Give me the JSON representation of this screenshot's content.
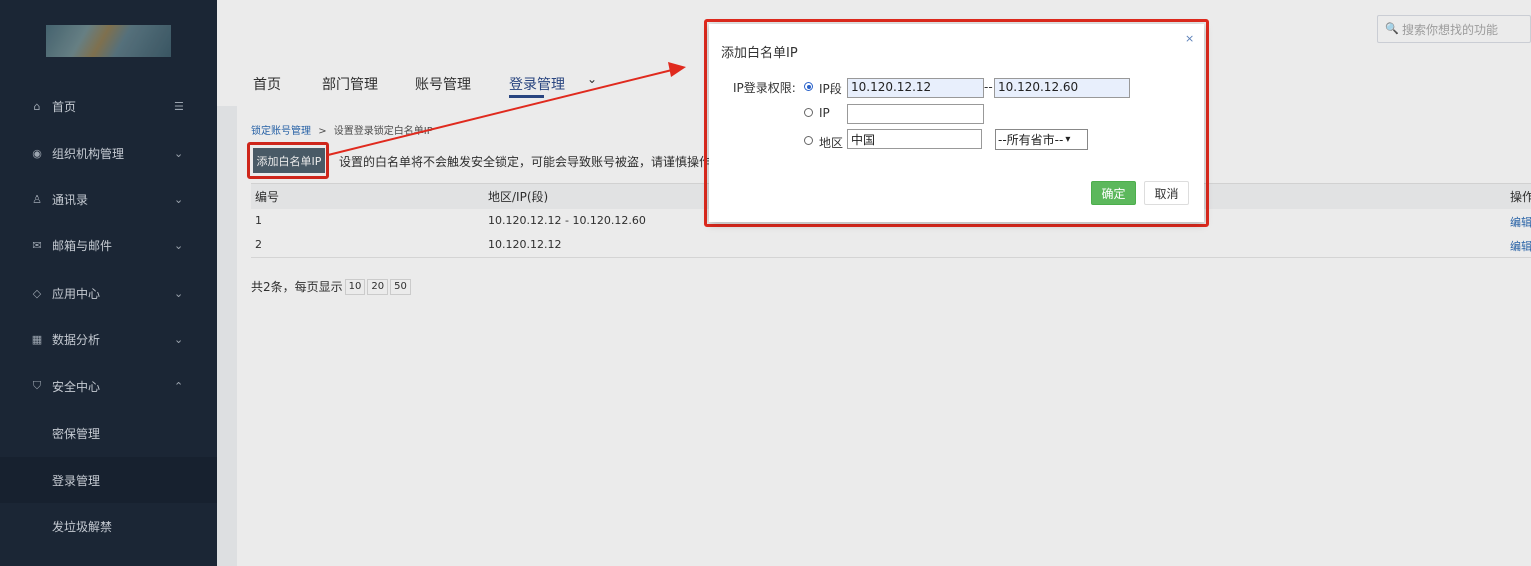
{
  "sidebar": {
    "items": [
      {
        "label": "首页",
        "icon": "home-icon"
      },
      {
        "label": "组织机构管理",
        "icon": "database-icon"
      },
      {
        "label": "通讯录",
        "icon": "contacts-icon"
      },
      {
        "label": "邮箱与邮件",
        "icon": "mail-icon"
      },
      {
        "label": "应用中心",
        "icon": "diamond-icon"
      },
      {
        "label": "数据分析",
        "icon": "chart-icon"
      },
      {
        "label": "安全中心",
        "icon": "shield-icon"
      }
    ],
    "subitems": [
      {
        "label": "密保管理"
      },
      {
        "label": "登录管理"
      },
      {
        "label": "发垃圾解禁"
      }
    ]
  },
  "header": {
    "search_placeholder": "搜索你想找的功能"
  },
  "tabs": [
    {
      "label": "首页"
    },
    {
      "label": "部门管理"
    },
    {
      "label": "账号管理"
    },
    {
      "label": "登录管理"
    }
  ],
  "breadcrumb": {
    "link": "锁定账号管理",
    "sep": ">",
    "current": "设置登录锁定白名单IP"
  },
  "toolbar": {
    "add_label": "添加白名单IP",
    "warning": "设置的白名单将不会触发安全锁定，可能会导致账号被盗，请谨慎操作"
  },
  "table": {
    "headers": [
      "编号",
      "地区/IP(段)",
      "操作"
    ],
    "rows": [
      {
        "id": "1",
        "range": "10.120.12.12 - 10.120.12.60",
        "action": "编辑"
      },
      {
        "id": "2",
        "range": "10.120.12.12",
        "action": "编辑"
      }
    ]
  },
  "pager": {
    "text": "共2条，每页显示",
    "sizes": [
      "10",
      "20",
      "50"
    ]
  },
  "modal": {
    "title": "添加白名单IP",
    "close": "×",
    "perm_label": "IP登录权限:",
    "opt_range": "IP段",
    "opt_ip": "IP",
    "opt_region": "地区",
    "range_start": "10.120.12.12",
    "range_sep": "--",
    "range_end": "10.120.12.60",
    "ip_value": "",
    "region_value": "中国",
    "province_select": "--所有省市--",
    "ok": "确定",
    "cancel": "取消"
  },
  "colors": {
    "sidebar_bg": "#1e2a3a",
    "accent": "#2c4a8a",
    "highlight_red": "#e02a1e",
    "ok_green": "#5cb85c"
  }
}
